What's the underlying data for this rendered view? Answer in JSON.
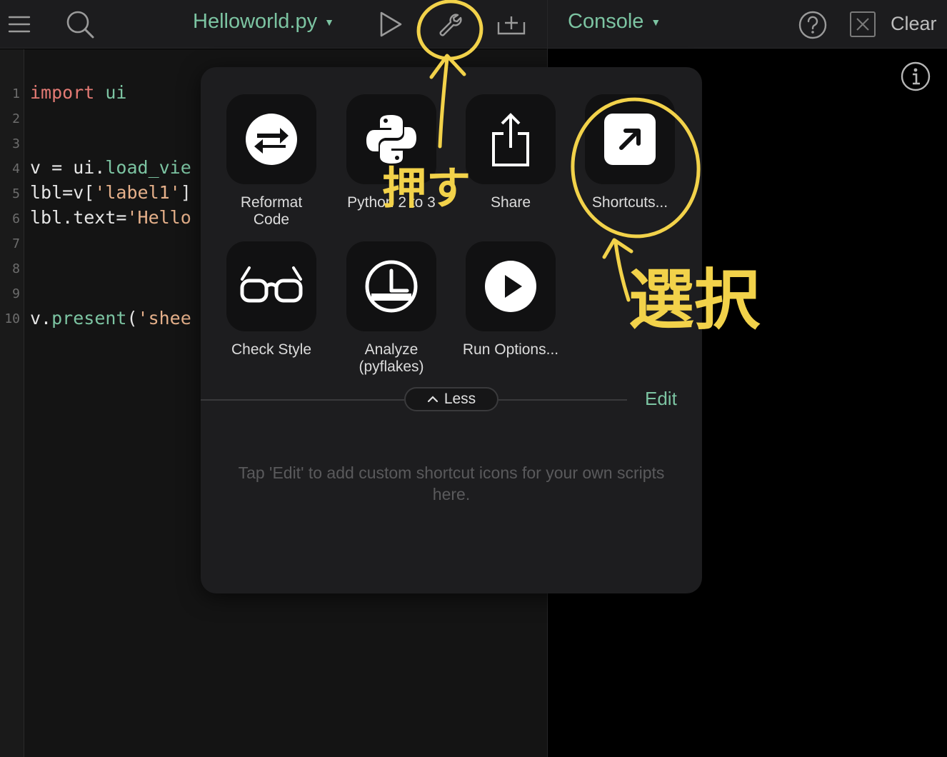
{
  "topbar": {
    "file_title": "Helloworld.py",
    "console_title": "Console",
    "clear_label": "Clear",
    "icons": [
      "menu-icon",
      "search-icon",
      "play-icon",
      "wrench-icon",
      "add-tab-icon",
      "help-icon",
      "close-icon"
    ]
  },
  "editor": {
    "line_numbers": [
      "1",
      "2",
      "3",
      "4",
      "5",
      "6",
      "7",
      "8",
      "9",
      "10"
    ],
    "line1": {
      "kw": "import",
      "rest": " ui"
    },
    "line4": {
      "a": "v = ui.",
      "fn": "load_vie"
    },
    "line5": {
      "a": "lbl=v[",
      "str": "'label1'",
      "b": "]"
    },
    "line6": {
      "a": "lbl.text=",
      "str": "'Hello"
    },
    "line10": {
      "a": "v.",
      "fn": "present",
      "b": "(",
      "str": "'shee"
    }
  },
  "popover": {
    "items": [
      {
        "label": "Reformat\nCode",
        "icon": "reformat-icon"
      },
      {
        "label": "Python 2 to 3",
        "icon": "python-icon"
      },
      {
        "label": "Share",
        "icon": "share-icon"
      },
      {
        "label": "Shortcuts...",
        "icon": "shortcut-arrow-icon"
      },
      {
        "label": "Check Style",
        "icon": "glasses-icon"
      },
      {
        "label": "Analyze\n(pyflakes)",
        "icon": "analyze-icon"
      },
      {
        "label": "Run Options...",
        "icon": "play-circle-icon"
      }
    ],
    "less_label": "Less",
    "edit_label": "Edit",
    "hint": "Tap 'Edit' to add custom shortcut icons for your own scripts here."
  },
  "annotations": {
    "press_text": "押す",
    "select_text": "選択",
    "color": "#f2d24a"
  },
  "colors": {
    "accent": "#7cc4a2",
    "keyword": "#e37a74",
    "string": "#e5b08a"
  }
}
